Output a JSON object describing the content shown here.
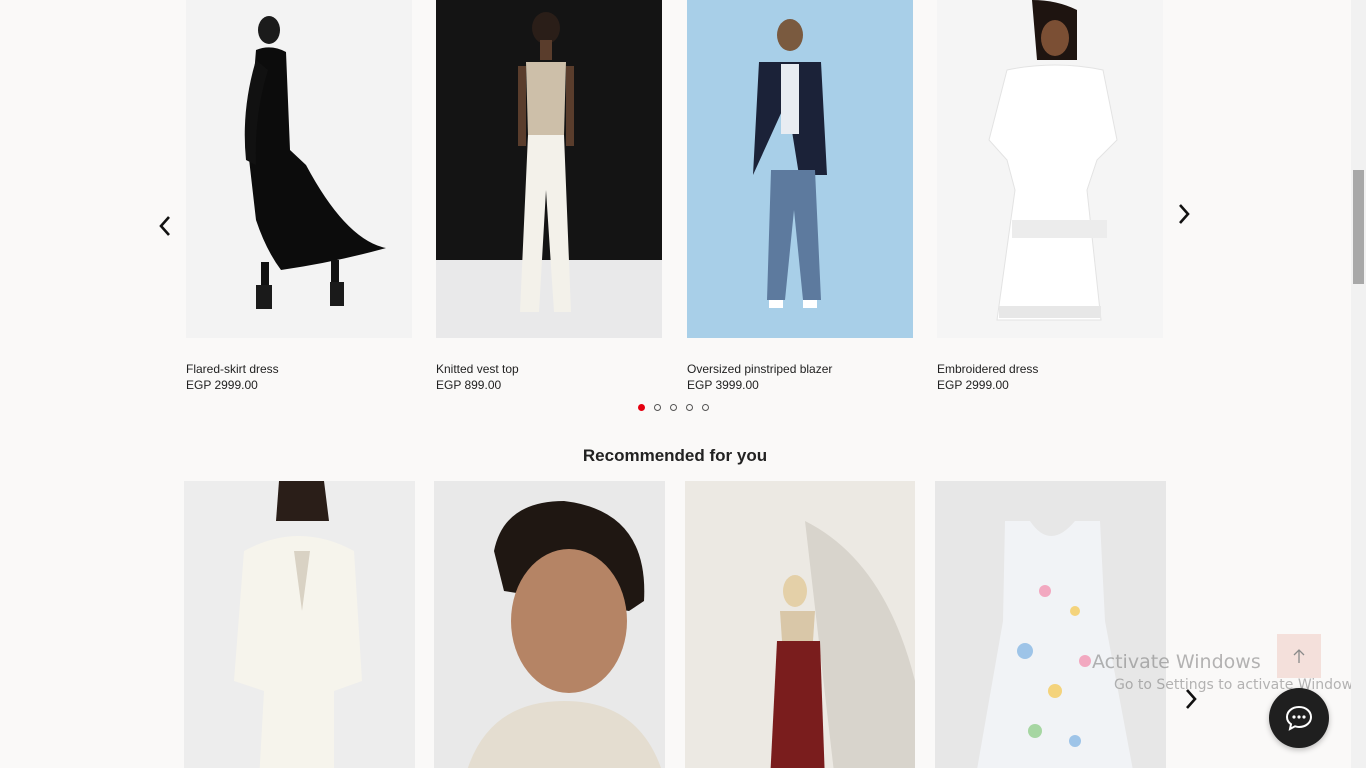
{
  "carousel": {
    "products": [
      {
        "name": "Flared-skirt dress",
        "price": "EGP 2999.00"
      },
      {
        "name": "Knitted vest top",
        "price": "EGP 899.00"
      },
      {
        "name": "Oversized pinstriped blazer",
        "price": "EGP 3999.00"
      },
      {
        "name": "Embroidered dress",
        "price": "EGP 2999.00"
      }
    ],
    "dots_total": 5,
    "dots_active": 1
  },
  "recommended": {
    "title": "Recommended for you"
  },
  "watermark": {
    "line1": "Activate Windows",
    "line2": "Go to Settings to activate Windows."
  },
  "colors": {
    "background": "#faf9f8",
    "accent": "#e50010",
    "chat_button": "#1f1f1f"
  },
  "icons": {
    "prev": "chevron-left-icon",
    "next": "chevron-right-icon",
    "scroll_top": "arrow-up-icon",
    "chat": "chat-bubble-icon"
  }
}
